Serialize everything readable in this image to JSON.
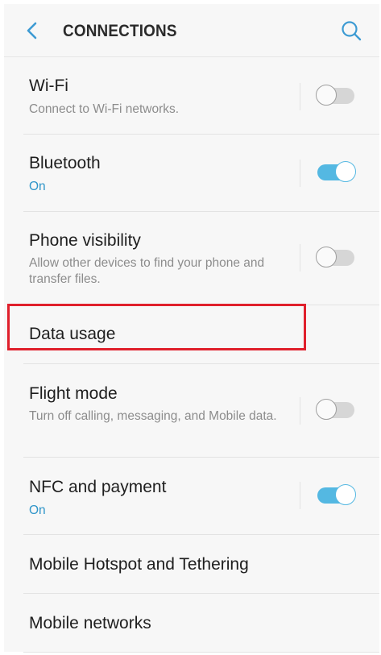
{
  "header": {
    "title": "CONNECTIONS",
    "back_icon": "chevron-left-icon",
    "search_icon": "search-icon"
  },
  "colors": {
    "accent": "#3d9bd3",
    "toggle_on": "#54b8e2",
    "highlight": "#e0202c"
  },
  "items": [
    {
      "title": "Wi-Fi",
      "subtitle": "Connect to Wi-Fi networks.",
      "toggle": "off"
    },
    {
      "title": "Bluetooth",
      "subtitle": "On",
      "toggle": "on"
    },
    {
      "title": "Phone visibility",
      "subtitle": "Allow other devices to find your phone and transfer files.",
      "toggle": "off"
    },
    {
      "title": "Data usage"
    },
    {
      "title": "Flight mode",
      "subtitle": "Turn off calling, messaging, and Mobile data.",
      "toggle": "off"
    },
    {
      "title": "NFC and payment",
      "subtitle": "On",
      "toggle": "on"
    },
    {
      "title": "Mobile Hotspot and Tethering"
    },
    {
      "title": "Mobile networks"
    }
  ]
}
